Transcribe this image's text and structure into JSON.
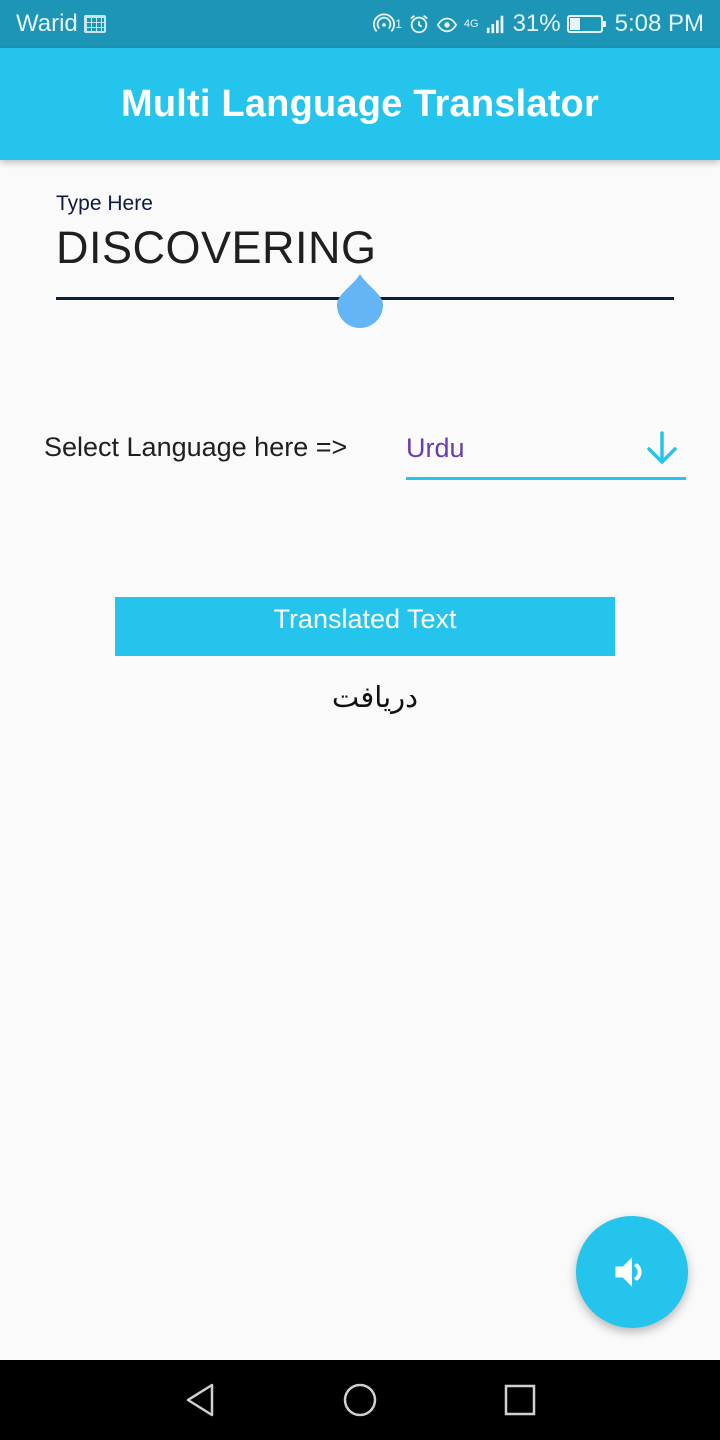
{
  "status_bar": {
    "carrier": "Warid",
    "network": "4G",
    "notification_count": "1",
    "battery": "31%",
    "battery_level": 0.31,
    "time": "5:08 PM",
    "icons": [
      "keyboard-icon",
      "hotspot-icon",
      "alarm-icon",
      "eye-comfort-icon",
      "signal-icon",
      "battery-icon"
    ]
  },
  "app_bar": {
    "title": "Multi Language Translator"
  },
  "input": {
    "label": "Type Here",
    "value": "DISCOVERING"
  },
  "language": {
    "label": "Select Language here =>",
    "selected": "Urdu",
    "icon": "arrow-down-icon"
  },
  "translation": {
    "header": "Translated Text",
    "output": "دریافت"
  },
  "fab": {
    "icon": "volume-up-icon"
  },
  "nav": {
    "icons": [
      "back-icon",
      "home-icon",
      "recents-icon"
    ]
  },
  "colors": {
    "accent": "#25c4ec",
    "status_bar": "#1c95b6",
    "selected_text": "#6a3bb1",
    "handle": "#64b5f6"
  }
}
